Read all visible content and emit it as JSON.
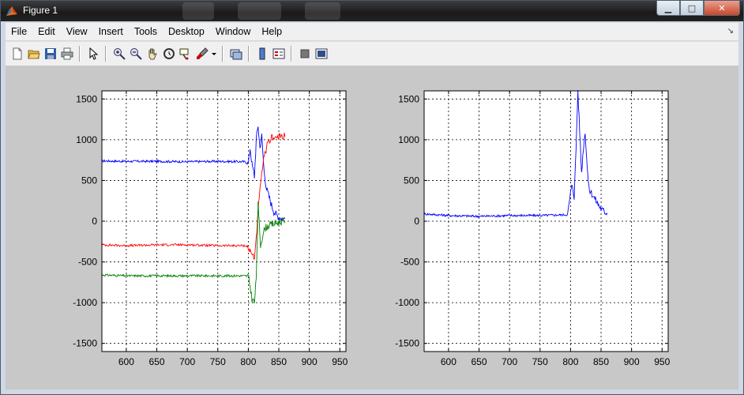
{
  "window": {
    "title": "Figure 1",
    "buttons": {
      "minimize": "▁",
      "maximize": "□",
      "close": "✕"
    }
  },
  "menubar": {
    "items": [
      "File",
      "Edit",
      "View",
      "Insert",
      "Tools",
      "Desktop",
      "Window",
      "Help"
    ],
    "dock_glyph": "↘"
  },
  "toolbar": {
    "tools": [
      "new-figure-icon",
      "open-file-icon",
      "save-icon",
      "print-icon",
      "select-arrow-icon",
      "zoom-in-icon",
      "zoom-out-icon",
      "pan-hand-icon",
      "rotate-3d-icon",
      "data-cursor-icon",
      "brush-icon",
      "link-plot-icon",
      "colorbar-icon",
      "legend-icon",
      "hide-plot-tools-icon",
      "show-plot-tools-icon"
    ]
  },
  "colors": {
    "blue": "#0000ff",
    "red": "#ff0000",
    "green": "#008000",
    "figure_bg": "#c8c8c8"
  },
  "chart_data": [
    {
      "type": "line",
      "xlim": [
        560,
        960
      ],
      "ylim": [
        -1600,
        1600
      ],
      "xticks": [
        600,
        650,
        700,
        750,
        800,
        850,
        900,
        950
      ],
      "yticks": [
        1500,
        1000,
        500,
        0,
        -500,
        -1000,
        -1500
      ],
      "grid": true,
      "series": [
        {
          "color": "blue",
          "x": [
            560,
            600,
            650,
            700,
            750,
            795,
            800,
            803,
            806,
            810,
            813,
            816,
            819,
            822,
            826,
            830,
            834,
            838,
            842,
            846,
            850,
            855,
            860
          ],
          "y": [
            740,
            735,
            735,
            730,
            735,
            730,
            700,
            900,
            700,
            550,
            1000,
            1180,
            900,
            1050,
            600,
            400,
            300,
            200,
            120,
            80,
            50,
            40,
            30
          ]
        },
        {
          "color": "red",
          "x": [
            560,
            600,
            650,
            700,
            750,
            795,
            800,
            803,
            806,
            810,
            813,
            816,
            820,
            824,
            828,
            832,
            836,
            840,
            845,
            850,
            855,
            860
          ],
          "y": [
            -290,
            -300,
            -290,
            -290,
            -300,
            -300,
            -320,
            -380,
            -400,
            -450,
            -200,
            100,
            450,
            700,
            850,
            950,
            1000,
            1050,
            1020,
            1030,
            1050,
            1040
          ]
        },
        {
          "color": "green",
          "x": [
            560,
            600,
            650,
            700,
            750,
            795,
            800,
            803,
            806,
            810,
            813,
            816,
            820,
            824,
            828,
            834,
            840,
            846,
            852,
            860
          ],
          "y": [
            -660,
            -670,
            -670,
            -670,
            -670,
            -670,
            -680,
            -800,
            -950,
            -1000,
            -700,
            200,
            -300,
            -150,
            -80,
            -50,
            -40,
            -20,
            -10,
            0
          ]
        }
      ]
    },
    {
      "type": "line",
      "xlim": [
        560,
        960
      ],
      "ylim": [
        -1600,
        1600
      ],
      "xticks": [
        600,
        650,
        700,
        750,
        800,
        850,
        900,
        950
      ],
      "yticks": [
        1500,
        1000,
        500,
        0,
        -500,
        -1000,
        -1500
      ],
      "grid": true,
      "series": [
        {
          "color": "blue",
          "x": [
            560,
            600,
            650,
            700,
            750,
            795,
            800,
            803,
            806,
            809,
            812,
            815,
            818,
            821,
            824,
            827,
            830,
            834,
            838,
            842,
            846,
            850,
            855,
            860
          ],
          "y": [
            90,
            70,
            60,
            70,
            70,
            80,
            350,
            450,
            300,
            900,
            1600,
            1100,
            600,
            900,
            1100,
            700,
            400,
            350,
            300,
            250,
            200,
            150,
            120,
            100
          ]
        }
      ]
    }
  ]
}
